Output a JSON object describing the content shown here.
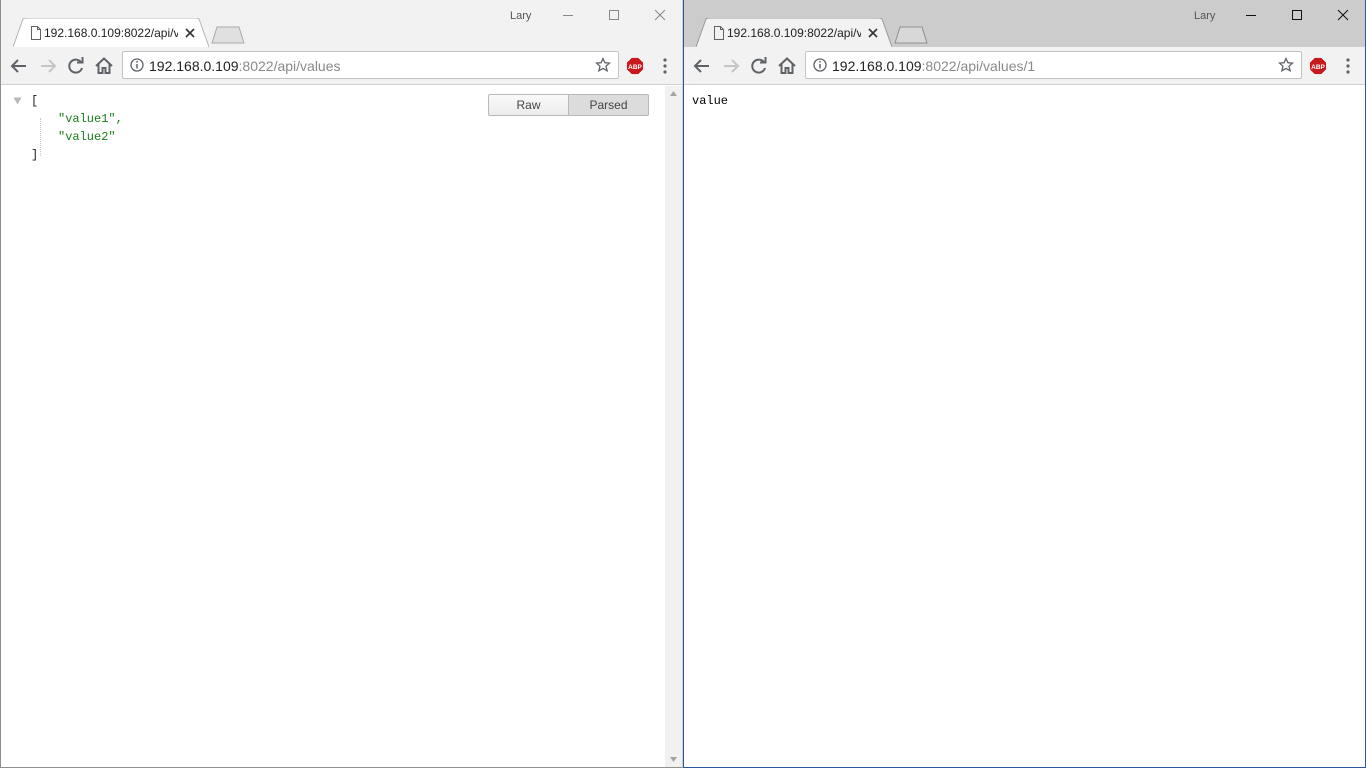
{
  "left_window": {
    "tab_title": "192.168.0.109:8022/api/v",
    "user": "Lary",
    "url_host": "192.168.0.109",
    "url_rest": ":8022/api/values",
    "buttons": {
      "raw": "Raw",
      "parsed": "Parsed"
    },
    "json_view": {
      "open_bracket": "[",
      "items": [
        "\"value1\",",
        "\"value2\""
      ],
      "close_bracket": "]"
    }
  },
  "right_window": {
    "tab_title": "192.168.0.109:8022/api/v",
    "user": "Lary",
    "url_host": "192.168.0.109",
    "url_rest": ":8022/api/values/1",
    "body_text": "value"
  },
  "colors": {
    "json_string": "#1a7f1a",
    "abp_red": "#c8191c",
    "focus_border": "#2b579a"
  }
}
